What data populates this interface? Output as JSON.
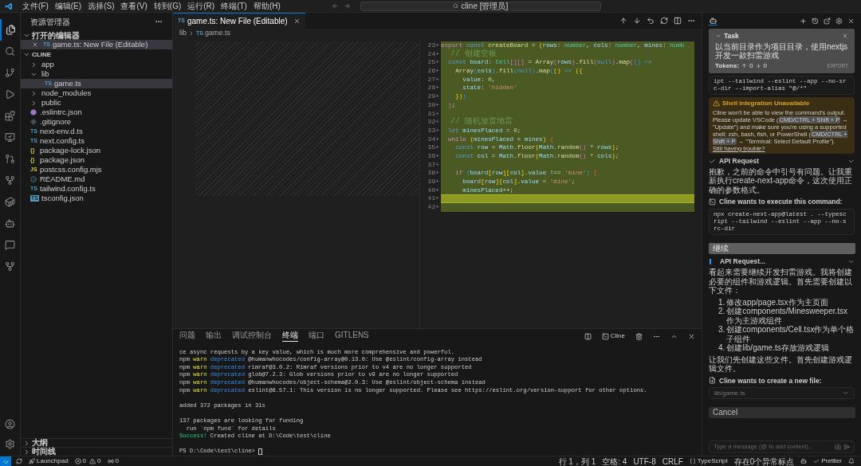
{
  "menu_bar": {
    "items": [
      "文件(F)",
      "编辑(E)",
      "选择(S)",
      "查看(V)",
      "转到(G)",
      "运行(R)",
      "终端(T)",
      "帮助(H)"
    ],
    "search": "cline [管理员]"
  },
  "sidebar": {
    "title": "资源管理器",
    "open_editors": {
      "title": "打开的编辑器",
      "expanded": true,
      "items": [
        {
          "label": "game.ts: New File (Editable)",
          "kind": "ts",
          "icon_label": "TS",
          "selected": true
        }
      ]
    },
    "folder": {
      "title": "CLINE",
      "expanded": true,
      "items": [
        {
          "label": "app",
          "kind": "folder",
          "expanded": false,
          "selected": false
        },
        {
          "label": "lib",
          "kind": "folder",
          "expanded": true,
          "selected": false,
          "children": [
            {
              "label": "game.ts",
              "kind": "ts",
              "icon_label": "TS",
              "selected": true
            }
          ]
        },
        {
          "label": "node_modules",
          "kind": "folder",
          "expanded": false,
          "selected": false
        },
        {
          "label": "public",
          "kind": "folder",
          "expanded": false,
          "selected": false
        },
        {
          "label": ".eslintrc.json",
          "kind": "eslint",
          "selected": false
        },
        {
          "label": ".gitignore",
          "kind": "git",
          "selected": false
        },
        {
          "label": "next-env.d.ts",
          "kind": "ts",
          "icon_label": "TS",
          "selected": false
        },
        {
          "label": "next.config.ts",
          "kind": "ts",
          "icon_label": "TS",
          "selected": false
        },
        {
          "label": "package-lock.json",
          "kind": "json",
          "icon_label": "{}",
          "selected": false
        },
        {
          "label": "package.json",
          "kind": "json",
          "icon_label": "{}",
          "selected": false
        },
        {
          "label": "postcss.config.mjs",
          "kind": "js",
          "icon_label": "JS",
          "selected": false
        },
        {
          "label": "README.md",
          "kind": "info",
          "selected": false
        },
        {
          "label": "tailwind.config.ts",
          "kind": "ts",
          "icon_label": "TS",
          "selected": false
        },
        {
          "label": "tsconfig.json",
          "kind": "tsconfig",
          "icon_label": "TS",
          "selected": false
        }
      ]
    },
    "bottom_sections": [
      {
        "title": "大纲",
        "expanded": false
      },
      {
        "title": "时间线",
        "expanded": false
      }
    ]
  },
  "editor": {
    "tab": {
      "icon_label": "TS",
      "label": "game.ts: New File (Editable)"
    },
    "breadcrumb": {
      "folder": "lib",
      "icon_label": "TS",
      "file": "game.ts"
    },
    "lines": [
      {
        "number": "23",
        "marker": "+",
        "current": false,
        "tokens": [
          {
            "kind": "control",
            "text": "export"
          },
          {
            "kind": "keyword",
            "text": " const"
          },
          {
            "kind": "function",
            "text": " createBoard"
          },
          {
            "kind": "punct",
            "text": " = "
          },
          {
            "kind": "bracket",
            "text": "("
          },
          {
            "kind": "variable",
            "text": "rows"
          },
          {
            "kind": "punct",
            "text": ": "
          },
          {
            "kind": "type",
            "text": "number"
          },
          {
            "kind": "punct",
            "text": ", "
          },
          {
            "kind": "variable",
            "text": "cols"
          },
          {
            "kind": "punct",
            "text": ": "
          },
          {
            "kind": "type",
            "text": "number"
          },
          {
            "kind": "punct",
            "text": ", "
          },
          {
            "kind": "variable",
            "text": "mines"
          },
          {
            "kind": "punct",
            "text": ": "
          },
          {
            "kind": "type",
            "text": "numb"
          }
        ]
      },
      {
        "number": "24",
        "marker": "+",
        "current": false,
        "tokens": [
          {
            "kind": "comment",
            "text": "  // 创建空板"
          }
        ]
      },
      {
        "number": "25",
        "marker": "+",
        "current": false,
        "tokens": [
          {
            "kind": "keyword",
            "text": "  const"
          },
          {
            "kind": "variable",
            "text": " board"
          },
          {
            "kind": "punct",
            "text": ": "
          },
          {
            "kind": "type",
            "text": "Cell"
          },
          {
            "kind": "bracket2",
            "text": "[][]"
          },
          {
            "kind": "punct",
            "text": " = "
          },
          {
            "kind": "function",
            "text": "Array"
          },
          {
            "kind": "bracket2",
            "text": "("
          },
          {
            "kind": "variable",
            "text": "rows"
          },
          {
            "kind": "bracket2",
            "text": ")"
          },
          {
            "kind": "punct",
            "text": "."
          },
          {
            "kind": "function",
            "text": "fill"
          },
          {
            "kind": "bracket2",
            "text": "("
          },
          {
            "kind": "keyword",
            "text": "null"
          },
          {
            "kind": "bracket2",
            "text": ")"
          },
          {
            "kind": "punct",
            "text": "."
          },
          {
            "kind": "function",
            "text": "map"
          },
          {
            "kind": "bracket2",
            "text": "("
          },
          {
            "kind": "bracket3",
            "text": "()"
          },
          {
            "kind": "keyword",
            "text": " =>"
          }
        ]
      },
      {
        "number": "26",
        "marker": "+",
        "current": false,
        "tokens": [
          {
            "kind": "function",
            "text": "    Array"
          },
          {
            "kind": "bracket3",
            "text": "("
          },
          {
            "kind": "variable",
            "text": "cols"
          },
          {
            "kind": "bracket3",
            "text": ")"
          },
          {
            "kind": "punct",
            "text": "."
          },
          {
            "kind": "function",
            "text": "fill"
          },
          {
            "kind": "bracket3",
            "text": "("
          },
          {
            "kind": "keyword",
            "text": "null"
          },
          {
            "kind": "bracket3",
            "text": ")"
          },
          {
            "kind": "punct",
            "text": "."
          },
          {
            "kind": "function",
            "text": "map"
          },
          {
            "kind": "bracket3",
            "text": "("
          },
          {
            "kind": "bracket",
            "text": "()"
          },
          {
            "kind": "keyword",
            "text": " =>"
          },
          {
            "kind": "bracket",
            "text": " ({"
          }
        ]
      },
      {
        "number": "27",
        "marker": "+",
        "current": false,
        "tokens": [
          {
            "kind": "variable",
            "text": "      value"
          },
          {
            "kind": "punct",
            "text": ": "
          },
          {
            "kind": "number",
            "text": "0"
          },
          {
            "kind": "punct",
            "text": ","
          }
        ]
      },
      {
        "number": "28",
        "marker": "+",
        "current": false,
        "tokens": [
          {
            "kind": "variable",
            "text": "      state"
          },
          {
            "kind": "punct",
            "text": ": "
          },
          {
            "kind": "string",
            "text": "'hidden'"
          }
        ]
      },
      {
        "number": "29",
        "marker": "+",
        "current": false,
        "tokens": [
          {
            "kind": "bracket",
            "text": "    })"
          },
          {
            "kind": "bracket3",
            "text": ")"
          }
        ]
      },
      {
        "number": "30",
        "marker": "+",
        "current": false,
        "tokens": [
          {
            "kind": "bracket2",
            "text": "  )"
          },
          {
            "kind": "punct",
            "text": ";"
          }
        ]
      },
      {
        "number": "31",
        "marker": "+",
        "current": false
      },
      {
        "number": "32",
        "marker": "+",
        "current": false,
        "tokens": [
          {
            "kind": "comment",
            "text": "  // 随机放置地雷"
          }
        ]
      },
      {
        "number": "33",
        "marker": "+",
        "current": false,
        "tokens": [
          {
            "kind": "keyword",
            "text": "  let"
          },
          {
            "kind": "variable",
            "text": " minesPlaced"
          },
          {
            "kind": "punct",
            "text": " = "
          },
          {
            "kind": "number",
            "text": "0"
          },
          {
            "kind": "punct",
            "text": ";"
          }
        ]
      },
      {
        "number": "34",
        "marker": "+",
        "current": false,
        "tokens": [
          {
            "kind": "control",
            "text": "  while"
          },
          {
            "kind": "bracket",
            "text": " ("
          },
          {
            "kind": "variable",
            "text": "minesPlaced"
          },
          {
            "kind": "punct",
            "text": " < "
          },
          {
            "kind": "variable",
            "text": "mines"
          },
          {
            "kind": "bracket",
            "text": ")"
          },
          {
            "kind": "red",
            "text": " {"
          }
        ]
      },
      {
        "number": "35",
        "marker": "+",
        "current": false,
        "tokens": [
          {
            "kind": "keyword",
            "text": "    const"
          },
          {
            "kind": "variable",
            "text": " row"
          },
          {
            "kind": "punct",
            "text": " = "
          },
          {
            "kind": "variable",
            "text": "Math"
          },
          {
            "kind": "punct",
            "text": "."
          },
          {
            "kind": "function",
            "text": "floor"
          },
          {
            "kind": "bracket",
            "text": "("
          },
          {
            "kind": "variable",
            "text": "Math"
          },
          {
            "kind": "punct",
            "text": "."
          },
          {
            "kind": "function",
            "text": "random"
          },
          {
            "kind": "bracket2",
            "text": "()"
          },
          {
            "kind": "punct",
            "text": " * "
          },
          {
            "kind": "variable",
            "text": "rows"
          },
          {
            "kind": "bracket",
            "text": ")"
          },
          {
            "kind": "punct",
            "text": ";"
          }
        ]
      },
      {
        "number": "36",
        "marker": "+",
        "current": false,
        "tokens": [
          {
            "kind": "keyword",
            "text": "    const"
          },
          {
            "kind": "variable",
            "text": " col"
          },
          {
            "kind": "punct",
            "text": " = "
          },
          {
            "kind": "variable",
            "text": "Math"
          },
          {
            "kind": "punct",
            "text": "."
          },
          {
            "kind": "function",
            "text": "floor"
          },
          {
            "kind": "bracket",
            "text": "("
          },
          {
            "kind": "variable",
            "text": "Math"
          },
          {
            "kind": "punct",
            "text": "."
          },
          {
            "kind": "function",
            "text": "random"
          },
          {
            "kind": "bracket2",
            "text": "()"
          },
          {
            "kind": "punct",
            "text": " * "
          },
          {
            "kind": "variable",
            "text": "cols"
          },
          {
            "kind": "bracket",
            "text": ")"
          },
          {
            "kind": "punct",
            "text": ";"
          }
        ]
      },
      {
        "number": "37",
        "marker": "+",
        "current": false
      },
      {
        "number": "38",
        "marker": "+",
        "current": false,
        "tokens": [
          {
            "kind": "control",
            "text": "    if"
          },
          {
            "kind": "bracket3",
            "text": " ("
          },
          {
            "kind": "variable",
            "text": "board"
          },
          {
            "kind": "bracket",
            "text": "["
          },
          {
            "kind": "variable",
            "text": "row"
          },
          {
            "kind": "bracket",
            "text": "]["
          },
          {
            "kind": "variable",
            "text": "col"
          },
          {
            "kind": "bracket",
            "text": "]"
          },
          {
            "kind": "punct",
            "text": "."
          },
          {
            "kind": "variable",
            "text": "value"
          },
          {
            "kind": "punct",
            "text": " !== "
          },
          {
            "kind": "string",
            "text": "'mine'"
          },
          {
            "kind": "bracket3",
            "text": ")"
          },
          {
            "kind": "red",
            "text": " {"
          }
        ]
      },
      {
        "number": "39",
        "marker": "+",
        "current": false,
        "tokens": [
          {
            "kind": "variable",
            "text": "      board"
          },
          {
            "kind": "bracket",
            "text": "["
          },
          {
            "kind": "variable",
            "text": "row"
          },
          {
            "kind": "bracket",
            "text": "]["
          },
          {
            "kind": "variable",
            "text": "col"
          },
          {
            "kind": "bracket",
            "text": "]"
          },
          {
            "kind": "punct",
            "text": "."
          },
          {
            "kind": "variable",
            "text": "value"
          },
          {
            "kind": "punct",
            "text": " = "
          },
          {
            "kind": "string",
            "text": "'mine'"
          },
          {
            "kind": "punct",
            "text": ";"
          }
        ]
      },
      {
        "number": "40",
        "marker": "+",
        "current": false,
        "tokens": [
          {
            "kind": "variable",
            "text": "      minesPlaced"
          },
          {
            "kind": "punct",
            "text": "++;"
          }
        ]
      },
      {
        "number": "41",
        "marker": "+",
        "current": true
      },
      {
        "number": "42",
        "marker": "+",
        "current": false
      }
    ]
  },
  "panel": {
    "tabs": [
      {
        "label": "问题",
        "selected": false
      },
      {
        "label": "输出",
        "selected": false
      },
      {
        "label": "调试控制台",
        "selected": false
      },
      {
        "label": "终端",
        "selected": true
      },
      {
        "label": "端口",
        "selected": false
      },
      {
        "label": "GITLENS",
        "selected": false
      }
    ],
    "terminal_name": "Cline",
    "lines": [
      {
        "segments": [
          {
            "kind": "plain",
            "text": "ce async requests by a key value, which is much more comprehensive and powerful."
          }
        ]
      },
      {
        "segments": [
          {
            "kind": "plain",
            "text": "npm"
          },
          {
            "kind": "warn",
            "text": " warn"
          },
          {
            "kind": "info",
            "text": " deprecated"
          },
          {
            "kind": "plain",
            "text": " @humanwhocodes/config-array@0.13.0: Use @eslint/config-array instead"
          }
        ]
      },
      {
        "segments": [
          {
            "kind": "plain",
            "text": "npm"
          },
          {
            "kind": "warn",
            "text": " warn"
          },
          {
            "kind": "info",
            "text": " deprecated"
          },
          {
            "kind": "plain",
            "text": " rimraf@3.0.2: Rimraf versions prior to v4 are no longer supported"
          }
        ]
      },
      {
        "segments": [
          {
            "kind": "plain",
            "text": "npm"
          },
          {
            "kind": "warn",
            "text": " warn"
          },
          {
            "kind": "info",
            "text": " deprecated"
          },
          {
            "kind": "plain",
            "text": " glob@7.2.3: Glob versions prior to v9 are no longer supported"
          }
        ]
      },
      {
        "segments": [
          {
            "kind": "plain",
            "text": "npm"
          },
          {
            "kind": "warn",
            "text": " warn"
          },
          {
            "kind": "info",
            "text": " deprecated"
          },
          {
            "kind": "plain",
            "text": " @humanwhocodes/object-schema@2.0.3: Use @eslint/object-schema instead"
          }
        ]
      },
      {
        "segments": [
          {
            "kind": "plain",
            "text": "npm"
          },
          {
            "kind": "warn",
            "text": " warn"
          },
          {
            "kind": "info",
            "text": " deprecated"
          },
          {
            "kind": "plain",
            "text": " eslint@8.57.1: This version is no longer supported. Please see https://eslint.org/version-support for other options."
          }
        ],
        "gap_after": true
      },
      {
        "segments": [
          {
            "kind": "plain",
            "text": "added 372 packages in 31s"
          }
        ],
        "gap_after": true
      },
      {
        "segments": [
          {
            "kind": "plain",
            "text": "137 packages are looking for funding"
          }
        ]
      },
      {
        "segments": [
          {
            "kind": "plain",
            "text": "  run `npm fund` for details"
          }
        ]
      },
      {
        "segments": [
          {
            "kind": "success",
            "text": "Success!"
          },
          {
            "kind": "plain",
            "text": " Created cline at D:\\Code\\test\\cline"
          }
        ],
        "gap_after": true
      },
      {
        "segments": [
          {
            "kind": "prompt",
            "text": "PS D:\\Code\\test\\cline> "
          }
        ],
        "cursor": true
      }
    ]
  },
  "cline": {
    "task": {
      "title": "Task",
      "text": "以当前目录作为项目目录，使用nextjs开发一款扫雷游戏",
      "tokens_label": "Tokens:",
      "tokens_up": "0",
      "tokens_down": "0",
      "export": "EXPORT"
    },
    "messages": [
      {
        "kind": "code",
        "text": "ipt --tailwind --eslint --app --no-src-dir --import-alias \"@/*\""
      },
      {
        "kind": "warning",
        "title": "Shell Integration Unavailable",
        "body": [
          {
            "kind": "text",
            "text": "Cline won't be able to view the command's output. Please update VSCode ("
          },
          {
            "kind": "code",
            "text": "CMD/CTRL + Shift + P"
          },
          {
            "kind": "text",
            "text": " → \"Update\") and make sure you're using a supported shell: zsh, bash, fish, or PowerShell ("
          },
          {
            "kind": "code",
            "text": "CMD/CTRL + Shift + P"
          },
          {
            "kind": "text",
            "text": " → \"Terminal: Select Default Profile\"). "
          },
          {
            "kind": "link",
            "text": "Still having trouble?"
          }
        ]
      },
      {
        "kind": "api",
        "title": "API Request",
        "done": true
      },
      {
        "kind": "text",
        "text": "抱歉，之前的命令中引号有问题。让我重新执行create-next-app命令，这次使用正确的参数格式。"
      },
      {
        "kind": "command_request",
        "label": "Cline wants to execute this command:"
      },
      {
        "kind": "code",
        "text": "npx create-next-app@latest . --typescript --tailwind --eslint --app --no-src-dir"
      },
      {
        "kind": "button",
        "label": "继续",
        "primary": true
      },
      {
        "kind": "api",
        "title": "API Request...",
        "done": false
      },
      {
        "kind": "text",
        "text": "看起来需要继续开发扫雷游戏。我将创建必要的组件和游戏逻辑。首先需要创建以下文件："
      },
      {
        "kind": "list",
        "items": [
          {
            "number": "1.",
            "text": "修改app/page.tsx作为主页面"
          },
          {
            "number": "2.",
            "text": "创建components/Minesweeper.tsx作为主游戏组件"
          },
          {
            "number": "3.",
            "text": "创建components/Cell.tsx作为单个格子组件"
          },
          {
            "number": "4.",
            "text": "创建lib/game.ts存放游戏逻辑"
          }
        ]
      },
      {
        "kind": "text",
        "text": "让我们先创建这些文件。首先创建游戏逻辑文件。"
      },
      {
        "kind": "file_request",
        "label": "Cline wants to create a new file:"
      },
      {
        "kind": "file",
        "path": "lib/game.ts"
      },
      {
        "kind": "button",
        "label": "Cancel",
        "primary": false
      }
    ],
    "input": {
      "placeholder": "Type a message (@ to add context)..."
    }
  },
  "status_bar": {
    "left": [
      {
        "kind": "sync"
      },
      {
        "kind": "launchpad",
        "text": "Launchpad"
      },
      {
        "kind": "problems",
        "errors": "0",
        "warnings": "0"
      },
      {
        "kind": "ports",
        "text": "0"
      }
    ],
    "right": [
      {
        "kind": "text",
        "text": "行 1，列 1"
      },
      {
        "kind": "text",
        "text": "空格: 4"
      },
      {
        "kind": "text",
        "text": "UTF-8"
      },
      {
        "kind": "text",
        "text": "CRLF"
      },
      {
        "kind": "language",
        "text": "TypeScript"
      },
      {
        "kind": "text",
        "text": "存在0个异常标点"
      },
      {
        "kind": "copilot"
      },
      {
        "kind": "check",
        "text": "Prettier"
      },
      {
        "kind": "bell"
      }
    ]
  }
}
